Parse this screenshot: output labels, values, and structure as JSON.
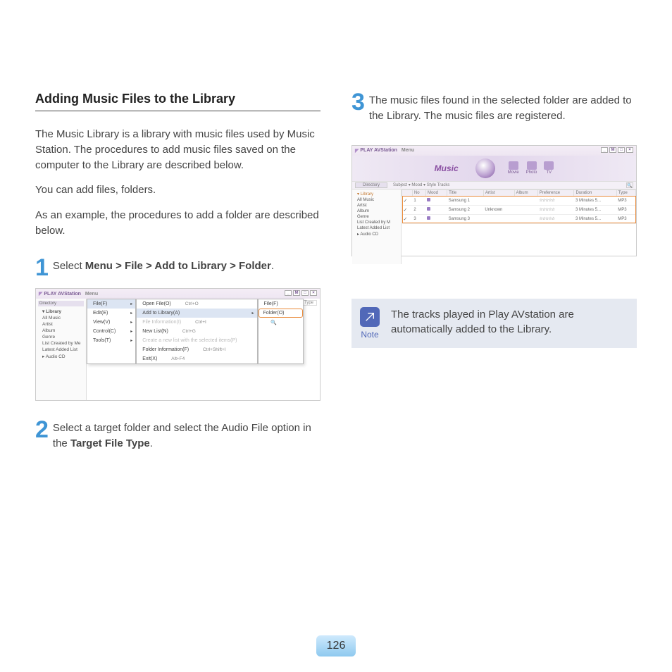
{
  "page_number": "126",
  "left": {
    "title": "Adding Music Files to the Library",
    "intro1": "The Music Library is a library with music files used by Music Station. The procedures to add music files saved on the computer to the Library are described below.",
    "intro2": "You can add files, folders.",
    "intro3": "As an example, the procedures to add a folder are described below.",
    "step1": {
      "num": "1",
      "prefix": "Select ",
      "bold": "Menu > File > Add to Library > Folder",
      "suffix": "."
    },
    "screenshot1": {
      "app_title": "PLAY AVStation",
      "menu_label": "Menu",
      "win_buttons": [
        "_",
        "M",
        "□",
        "×"
      ],
      "directory_label": "Directory",
      "sidebar": [
        "Library",
        "All Music",
        "Artist",
        "Album",
        "Genre",
        "List Created by Me",
        "Latest Added List",
        "Audio CD"
      ],
      "list_headers": [
        "...",
        "Type"
      ],
      "menu1": [
        "File(F)",
        "Edit(E)",
        "View(V)",
        "Control(C)",
        "Tools(T)"
      ],
      "menu2": [
        {
          "label": "Open File(O)",
          "kb": "Ctrl+O"
        },
        {
          "label": "Add to Library(A)",
          "sel": true,
          "arrow": true
        },
        {
          "label": "File Information(I)",
          "kb": "Ctrl+I",
          "dim": true
        },
        {
          "label": "New List(N)",
          "kb": "Ctrl+G"
        },
        {
          "label": "Create a new list with the selected items(P)",
          "dim": true
        },
        {
          "label": "Folder Information(F)",
          "kb": "Ctrl+Shift+I"
        },
        {
          "label": "Exit(X)",
          "kb": "Alt+F4"
        }
      ],
      "menu3": [
        "File(F)",
        "Folder(O)"
      ]
    },
    "step2": {
      "num": "2",
      "t1": "Select a target folder and select the Audio File option in the ",
      "bold": "Target File Type",
      "t2": "."
    }
  },
  "right": {
    "step3": {
      "num": "3",
      "text": "The music files found in the selected folder are added to the Library. The music files are registered."
    },
    "screenshot2": {
      "app_title": "PLAY AVStation",
      "menu_label": "Menu",
      "win_buttons": [
        "_",
        "M",
        "□",
        "×"
      ],
      "banner_title": "Music",
      "nav": [
        "Movie",
        "Photo",
        "TV"
      ],
      "directory_label": "Directory",
      "toolbar": "Subject ▾   Mood ▾   Style   Tracks",
      "sidebar": [
        "Library",
        "All Music",
        "Artist",
        "Album",
        "Genre",
        "List Created by M",
        "Latest Added List",
        "Audio CD"
      ],
      "columns": [
        "",
        "No",
        "Mood",
        "Title",
        "Artist",
        "Album",
        "Preference",
        "Duration",
        "Type"
      ],
      "rows": [
        {
          "no": "1",
          "title": "Samsung 1",
          "artist": "",
          "album": "",
          "dur": "3 Minutes 5...",
          "type": "MP3"
        },
        {
          "no": "2",
          "title": "Samsung 2",
          "artist": "Unknown",
          "album": "",
          "dur": "3 Minutes 5...",
          "type": "MP3"
        },
        {
          "no": "3",
          "title": "Samsung 3",
          "artist": "",
          "album": "",
          "dur": "3 Minutes 5...",
          "type": "MP3"
        }
      ]
    },
    "note": {
      "label": "Note",
      "text": "The tracks played in Play AVstation are automatically added to the Library."
    }
  }
}
